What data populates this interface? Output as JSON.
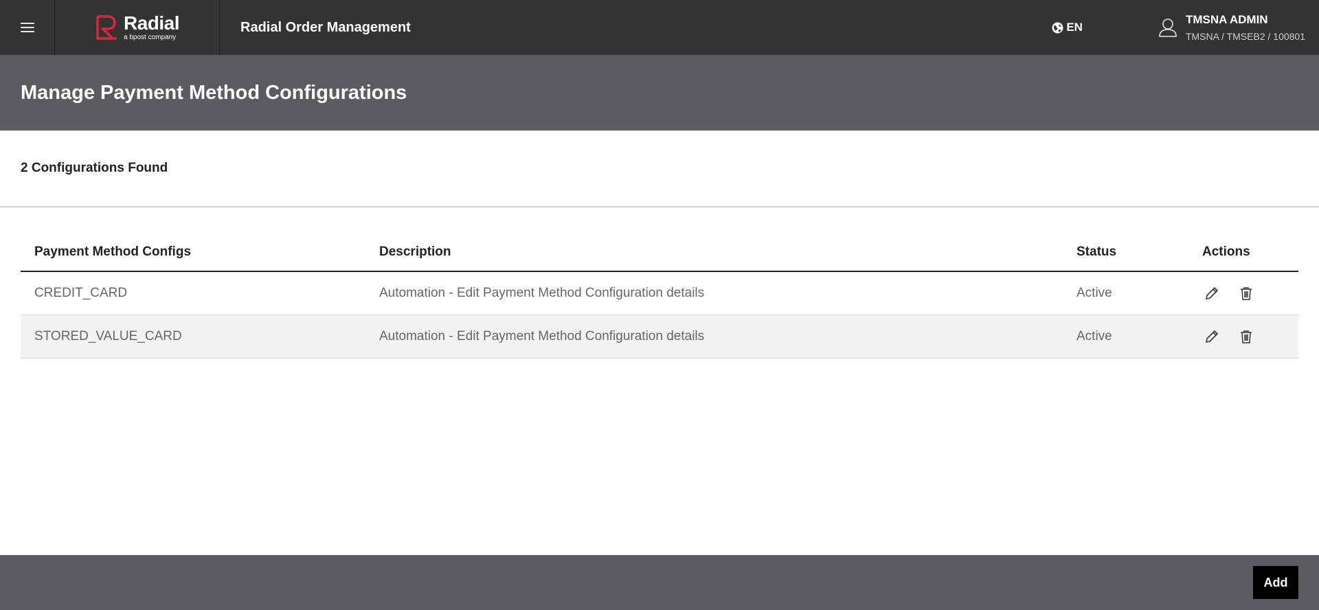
{
  "topbar": {
    "logo_name": "Radial",
    "logo_sub": "a bpost company",
    "app_title": "Radial Order Management",
    "language": "EN",
    "user_name": "TMSNA ADMIN",
    "user_org": "TMSNA / TMSEB2 / 100801",
    "brand_color": "#d7283b"
  },
  "page": {
    "title": "Manage Payment Method Configurations",
    "count_text": "2 Configurations Found"
  },
  "table": {
    "headers": {
      "name": "Payment Method Configs",
      "description": "Description",
      "status": "Status",
      "actions": "Actions"
    },
    "rows": [
      {
        "name": "CREDIT_CARD",
        "description": "Automation - Edit Payment Method Configuration details",
        "status": "Active"
      },
      {
        "name": "STORED_VALUE_CARD",
        "description": "Automation - Edit Payment Method Configuration details",
        "status": "Active"
      }
    ]
  },
  "footer": {
    "add_label": "Add"
  }
}
